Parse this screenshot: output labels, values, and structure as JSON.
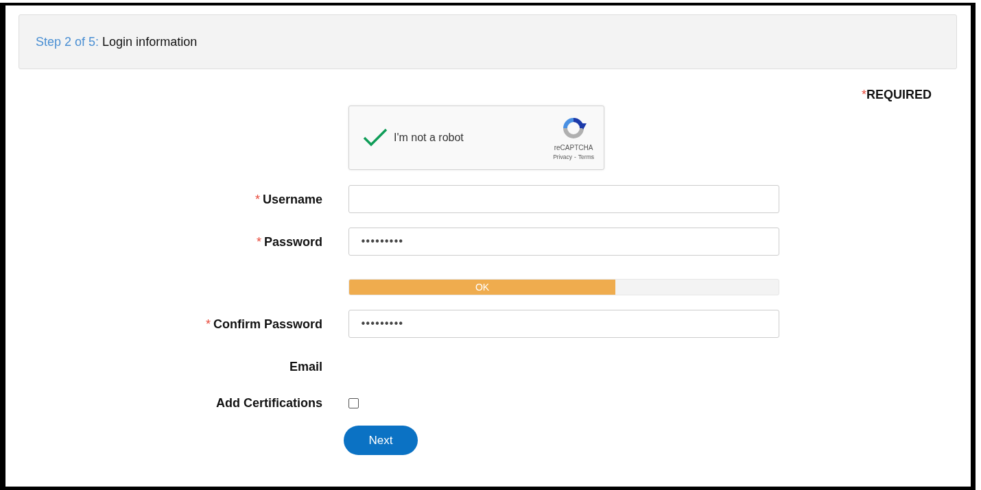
{
  "header": {
    "step": "Step 2 of 5:",
    "title": "Login information"
  },
  "required_mark": "*",
  "required_note": "REQUIRED",
  "captcha": {
    "checked": true,
    "label": "I'm not a robot",
    "brand": "reCAPTCHA",
    "privacy": "Privacy",
    "separator": "-",
    "terms": "Terms"
  },
  "fields": [
    {
      "kind": "text",
      "label": "Username",
      "required": true
    },
    {
      "kind": "password",
      "label": "Password",
      "required": true,
      "value": "•••••••••"
    },
    {
      "kind": "meter",
      "level": 0.62,
      "reading": "OK"
    },
    {
      "kind": "password",
      "label": "Confirm Password",
      "required": true,
      "value": "•••••••••"
    },
    {
      "kind": "label",
      "label": "Email",
      "required": false
    },
    {
      "kind": "checkbox",
      "label": "Add Certifications",
      "required": false,
      "checked": false
    }
  ],
  "button": "Next"
}
